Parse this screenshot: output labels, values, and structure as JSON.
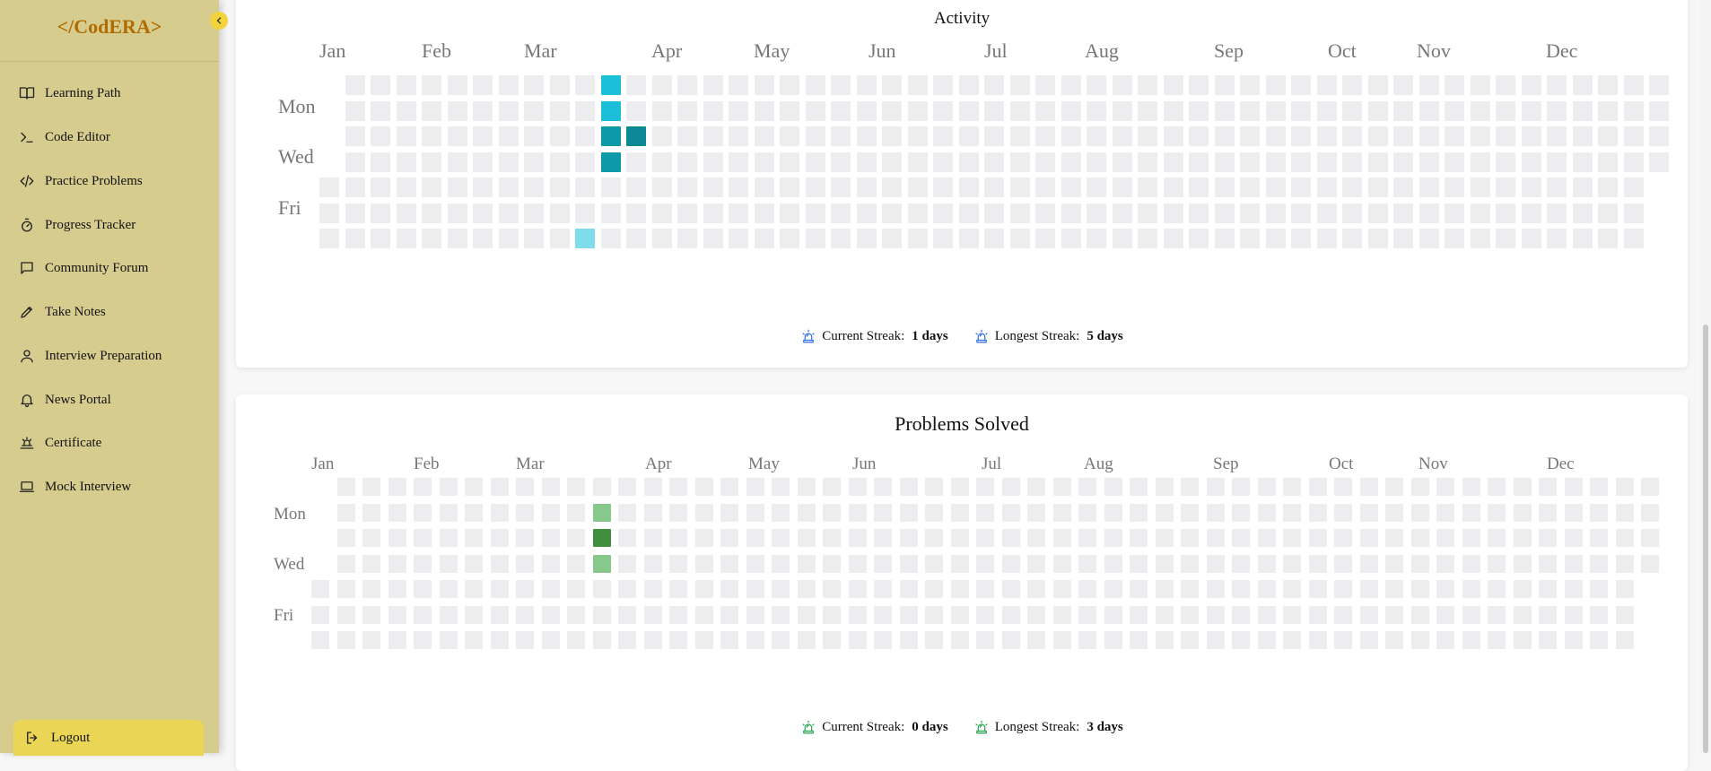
{
  "app": {
    "logo": "</CodERA>"
  },
  "colors": {
    "sidebar": "#d6cc8e",
    "accent": "#f2d33b",
    "logo": "#b06c00",
    "empty_cell": "#ededf0",
    "activity_scale": [
      "#ededf0",
      "#7fdcea",
      "#1bbfd8",
      "#0d99a8",
      "#0b8a96"
    ],
    "problems_scale": [
      "#ededf0",
      "#86c98a",
      "#3f8f3f"
    ],
    "streak_icon_activity": "#2f6fe0",
    "streak_icon_problems": "#22a34a"
  },
  "sidebar": {
    "items": [
      {
        "label": "Learning Path",
        "icon": "book-icon"
      },
      {
        "label": "Code Editor",
        "icon": "terminal-icon"
      },
      {
        "label": "Practice Problems",
        "icon": "code-icon"
      },
      {
        "label": "Progress Tracker",
        "icon": "timer-icon"
      },
      {
        "label": "Community Forum",
        "icon": "message-icon"
      },
      {
        "label": "Take Notes",
        "icon": "pen-icon"
      },
      {
        "label": "Interview Preparation",
        "icon": "user-icon"
      },
      {
        "label": "News Portal",
        "icon": "bell-icon"
      },
      {
        "label": "Certificate",
        "icon": "award-icon"
      },
      {
        "label": "Mock Interview",
        "icon": "laptop-icon"
      }
    ],
    "logout": "Logout"
  },
  "activity": {
    "title": "Activity",
    "months": [
      "Jan",
      "Feb",
      "Mar",
      "Apr",
      "May",
      "Jun",
      "Jul",
      "Aug",
      "Sep",
      "Oct",
      "Nov",
      "Dec"
    ],
    "days": [
      "Mon",
      "Wed",
      "Fri"
    ],
    "active_cells": [
      {
        "week": 11,
        "day": 0,
        "level": 2
      },
      {
        "week": 11,
        "day": 1,
        "level": 2
      },
      {
        "week": 11,
        "day": 2,
        "level": 3
      },
      {
        "week": 12,
        "day": 2,
        "level": 4
      },
      {
        "week": 11,
        "day": 3,
        "level": 3
      },
      {
        "week": 10,
        "day": 6,
        "level": 1
      }
    ],
    "current_streak_label": "Current Streak:",
    "current_streak_value": "1 days",
    "longest_streak_label": "Longest Streak:",
    "longest_streak_value": "5 days"
  },
  "problems": {
    "title": "Problems Solved",
    "months": [
      "Jan",
      "Feb",
      "Mar",
      "Apr",
      "May",
      "Jun",
      "Jul",
      "Aug",
      "Sep",
      "Oct",
      "Nov",
      "Dec"
    ],
    "days": [
      "Mon",
      "Wed",
      "Fri"
    ],
    "active_cells": [
      {
        "week": 11,
        "day": 1,
        "level": 1
      },
      {
        "week": 11,
        "day": 2,
        "level": 2
      },
      {
        "week": 11,
        "day": 3,
        "level": 1
      }
    ],
    "current_streak_label": "Current Streak:",
    "current_streak_value": "0 days",
    "longest_streak_label": "Longest Streak:",
    "longest_streak_value": "3 days"
  }
}
